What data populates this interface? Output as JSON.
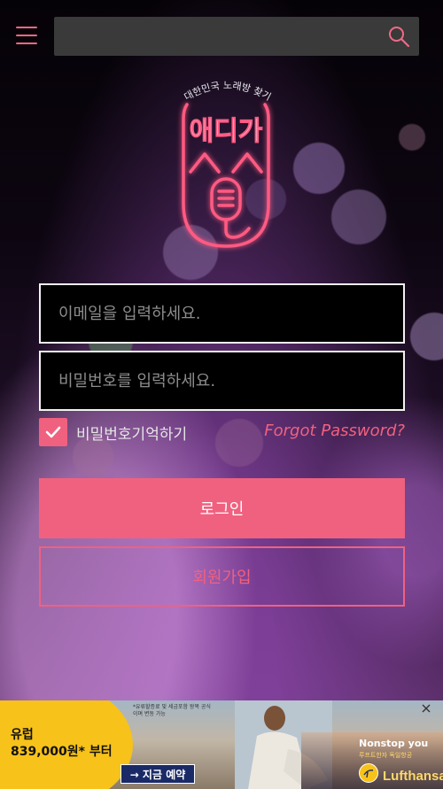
{
  "header": {
    "search_placeholder": "",
    "accent_color": "#f0617f"
  },
  "logo": {
    "alt": "애디가 앱 로고",
    "arc_text": "대한민국 노래방 찾기",
    "mark_text": "애디가"
  },
  "login_form": {
    "email_placeholder": "이메일을 입력하세요.",
    "password_placeholder": "비밀번호를 입력하세요.",
    "remember_label": "비밀번호기억하기",
    "remember_checked": true,
    "forgot_label": "Forgot Password?",
    "login_label": "로그인",
    "signup_label": "회원가입"
  },
  "ad": {
    "destination": "유럽",
    "price": "839,000원* 부터",
    "fine_print": "*유류할증료 및 세금포함 왕복 공식이며 변동 가능",
    "cta_label": "→ 지금 예약",
    "tagline": "Nonstop you",
    "sub_tagline": "루프트한자 독일항공",
    "brand": "Lufthansa"
  }
}
